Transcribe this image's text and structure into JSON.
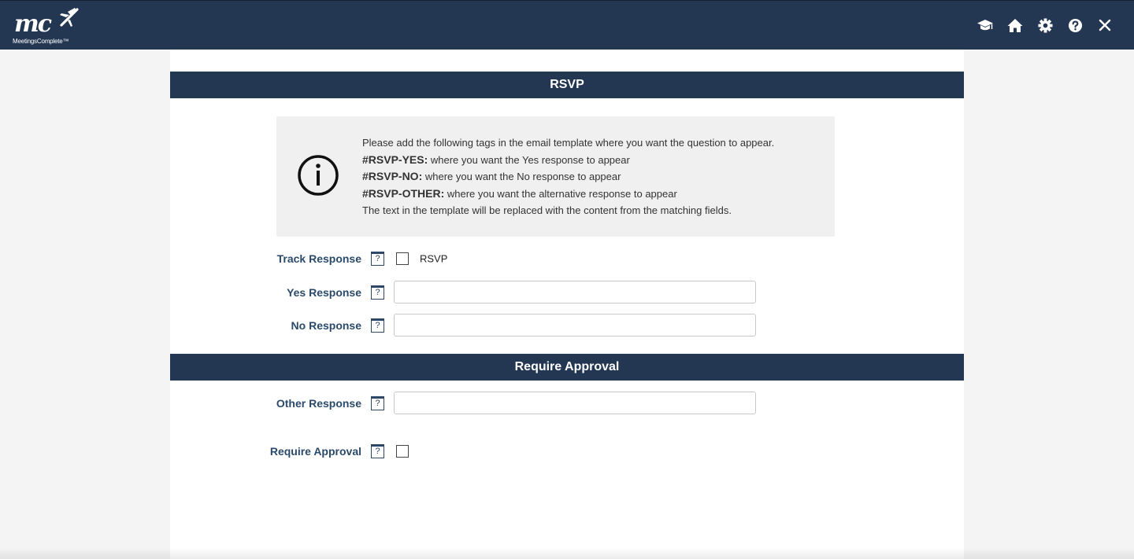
{
  "header": {
    "logo_text": "mc",
    "logo_tagline": "MeetingsComplete™",
    "icons": [
      "graduation-cap-icon",
      "home-icon",
      "gear-icon",
      "help-icon",
      "close-icon"
    ]
  },
  "sections": {
    "rsvp_title": "RSVP",
    "approval_title": "Require Approval"
  },
  "info": {
    "intro": "Please add the following tags in the email template where you want the question to appear.",
    "yes_tag": "#RSVP-YES:",
    "yes_desc": " where you want the Yes response to appear",
    "no_tag": "#RSVP-NO:",
    "no_desc": " where you want the No response to appear",
    "other_tag": "#RSVP-OTHER:",
    "other_desc": " where you want the alternative response to appear",
    "footer": "The text in the template will be replaced with the content from the matching fields."
  },
  "form": {
    "track_response_label": "Track Response",
    "track_response_checkbox_label": "RSVP",
    "track_response_checked": false,
    "yes_response_label": "Yes Response",
    "yes_response_value": "",
    "no_response_label": "No Response",
    "no_response_value": "",
    "other_response_label": "Other Response",
    "other_response_value": "",
    "require_approval_label": "Require Approval",
    "require_approval_checked": false,
    "help_glyph": "?"
  },
  "colors": {
    "header_bg": "#233753",
    "section_bg": "#233753",
    "label_color": "#2a4a6b",
    "info_bg": "#f0f0f0",
    "page_bg": "#f4f4f4"
  }
}
